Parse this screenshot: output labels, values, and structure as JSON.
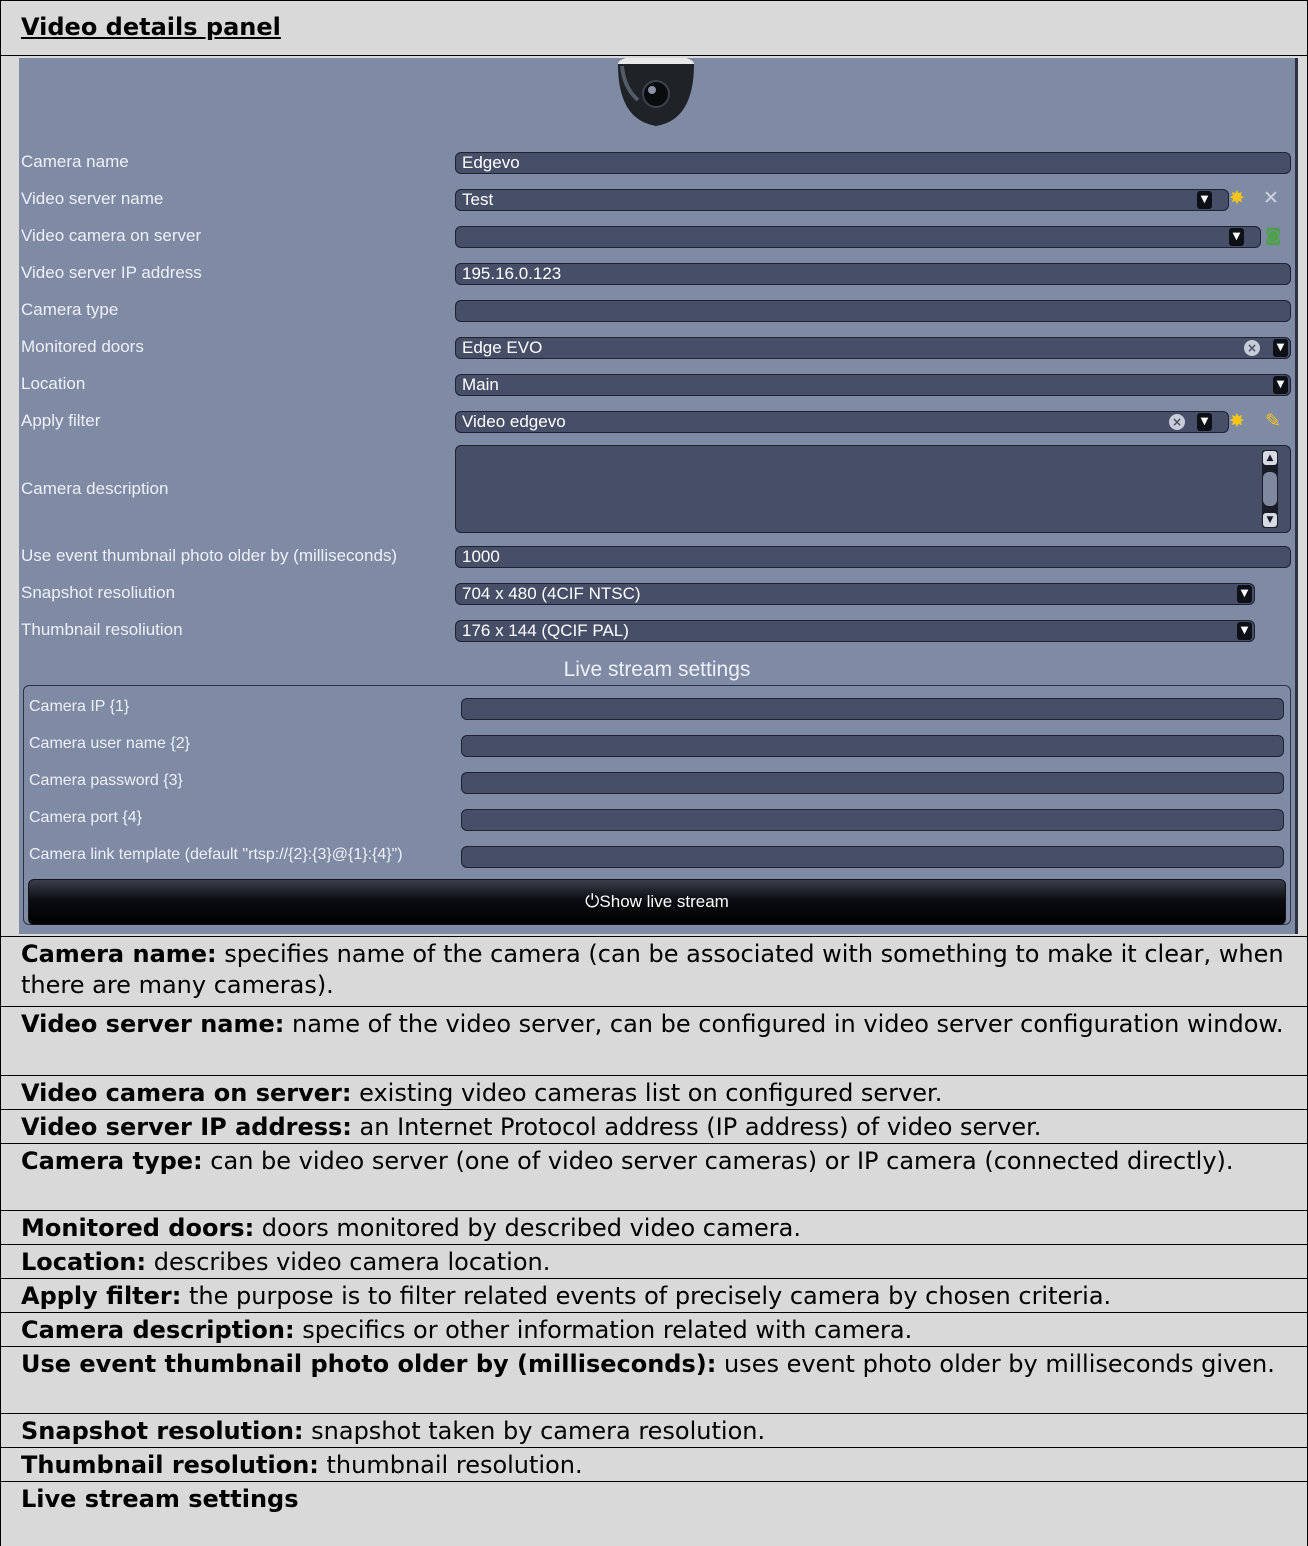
{
  "header": {
    "title": "Video details panel"
  },
  "form": {
    "camera_name": {
      "label": "Camera name",
      "value": "Edgevo"
    },
    "video_server_name": {
      "label": "Video server name",
      "value": "Test"
    },
    "video_camera_on_server": {
      "label": "Video camera on server",
      "value": ""
    },
    "video_server_ip": {
      "label": "Video server IP address",
      "value": "195.16.0.123"
    },
    "camera_type": {
      "label": "Camera type",
      "value": ""
    },
    "monitored_doors": {
      "label": "Monitored doors",
      "value": "Edge EVO"
    },
    "location": {
      "label": "Location",
      "value": "Main"
    },
    "apply_filter": {
      "label": "Apply filter",
      "value": "Video edgevo"
    },
    "camera_description": {
      "label": "Camera description",
      "value": ""
    },
    "thumbnail_older_by": {
      "label": "Use event thumbnail photo older by (milliseconds)",
      "value": "1000"
    },
    "snapshot_resolution": {
      "label": "Snapshot resoliution",
      "value": "704 x 480 (4CIF NTSC)"
    },
    "thumbnail_resolution": {
      "label": "Thumbnail resoliution",
      "value": "176 x 144 (QCIF PAL)"
    }
  },
  "live_stream": {
    "title": "Live stream settings",
    "camera_ip": "Camera IP {1}",
    "camera_user_name": "Camera user name {2}",
    "camera_password": "Camera password {3}",
    "camera_port": "Camera port {4}",
    "camera_link_template": "Camera link template (default \"rtsp://{2}:{3}@{1}:{4}\")",
    "show_button": "Show live stream"
  },
  "icons": {
    "dropdown": "triangle-down",
    "clear": "circle-x",
    "new": "star-burst",
    "settings": "tools",
    "browse": "camera-green",
    "edit": "pencil",
    "live": "plug"
  },
  "descriptions": [
    {
      "term": "Camera name:",
      "text": " specifies name of the camera (can be associated with something to make it clear, when there are many cameras)."
    },
    {
      "term": "Video server name:",
      "text": " name of the video server, can be configured in video server configuration window."
    },
    {
      "term": "Video camera on server:",
      "text": " existing video cameras list on configured server."
    },
    {
      "term": "Video server IP address:",
      "text": " an Internet Protocol address (IP address) of video server."
    },
    {
      "term": "Camera type:",
      "text": " can be video server (one of video server cameras) or IP camera (connected directly)."
    },
    {
      "term": "Monitored doors:",
      "text": " doors monitored by described video camera."
    },
    {
      "term": "Location:",
      "text": " describes video camera location."
    },
    {
      "term": "Apply filter:",
      "text": " the purpose is to filter related events of precisely camera by chosen criteria."
    },
    {
      "term": "Camera description:",
      "text": " specifics or other information related with camera."
    },
    {
      "term": "Use event thumbnail photo older by (milliseconds):",
      "text": " uses event photo older by milliseconds given."
    },
    {
      "term": "Snapshot resolution:",
      "text": " snapshot taken by camera resolution."
    },
    {
      "term": "Thumbnail resolution:",
      "text": " thumbnail resolution."
    },
    {
      "term": "Live stream settings",
      "text": ""
    }
  ]
}
